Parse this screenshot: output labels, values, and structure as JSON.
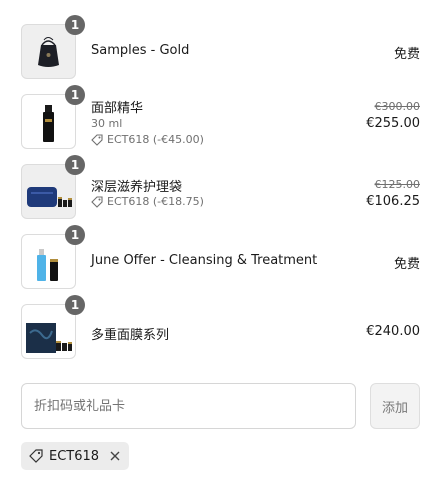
{
  "items": [
    {
      "qty": "1",
      "name": "Samples - Gold",
      "price": "免费",
      "thumb": "samples-pouch"
    },
    {
      "qty": "1",
      "name": "面部精华",
      "variant": "30 ml",
      "discount": "ECT618 (-€45.00)",
      "old_price": "€300.00",
      "price": "€255.00",
      "thumb": "serum-bottle"
    },
    {
      "qty": "1",
      "name": "深层滋养护理袋",
      "discount": "ECT618 (-€18.75)",
      "old_price": "€125.00",
      "price": "€106.25",
      "thumb": "care-pouch-set"
    },
    {
      "qty": "1",
      "name": "June Offer - Cleansing & Treatment",
      "price": "免费",
      "thumb": "cleansing-bottles"
    },
    {
      "qty": "1",
      "name": "多重面膜系列",
      "price": "€240.00",
      "thumb": "mask-set-box"
    }
  ],
  "discount_form": {
    "placeholder": "折扣码或礼品卡",
    "apply_label": "添加"
  },
  "applied_code": {
    "code": "ECT618"
  },
  "icons": {
    "tag": "tag-icon",
    "remove": "close-icon"
  },
  "colors": {
    "badge": "#666666",
    "muted": "#707070",
    "chip_bg": "#ececec"
  }
}
